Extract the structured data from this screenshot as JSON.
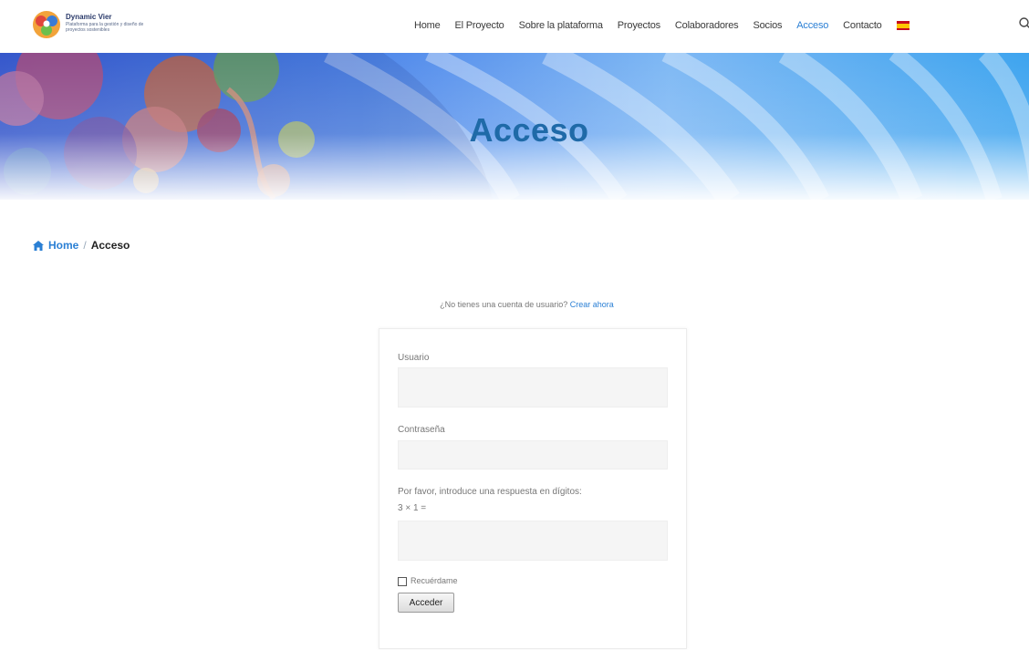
{
  "header": {
    "logo": {
      "title": "Dynamic Vier",
      "subtitle": "Plataforma para la gestión y diseño de proyectos sostenibles"
    },
    "nav": [
      {
        "label": "Home",
        "active": false
      },
      {
        "label": "El Proyecto",
        "active": false
      },
      {
        "label": "Sobre la plataforma",
        "active": false
      },
      {
        "label": "Proyectos",
        "active": false
      },
      {
        "label": "Colaboradores",
        "active": false
      },
      {
        "label": "Socios",
        "active": false
      },
      {
        "label": "Acceso",
        "active": true
      },
      {
        "label": "Contacto",
        "active": false
      }
    ],
    "language_flag": "spain-flag-icon",
    "search_icon": "search-icon"
  },
  "hero": {
    "title": "Acceso"
  },
  "breadcrumb": {
    "home": "Home",
    "separator": "/",
    "current": "Acceso"
  },
  "register": {
    "text": "¿No tienes una cuenta de usuario?",
    "link": "Crear ahora"
  },
  "login_form": {
    "username_label": "Usuario",
    "username_value": "",
    "password_label": "Contraseña",
    "password_value": "",
    "captcha_label": "Por favor, introduce una respuesta en dígitos:",
    "captcha_question": "3 × 1 =",
    "captcha_value": "",
    "remember_label": "Recuérdame",
    "remember_checked": false,
    "submit_label": "Acceder"
  },
  "colors": {
    "accent": "#2a7fd4",
    "hero_title": "#1f6aa8",
    "text": "#444444"
  }
}
